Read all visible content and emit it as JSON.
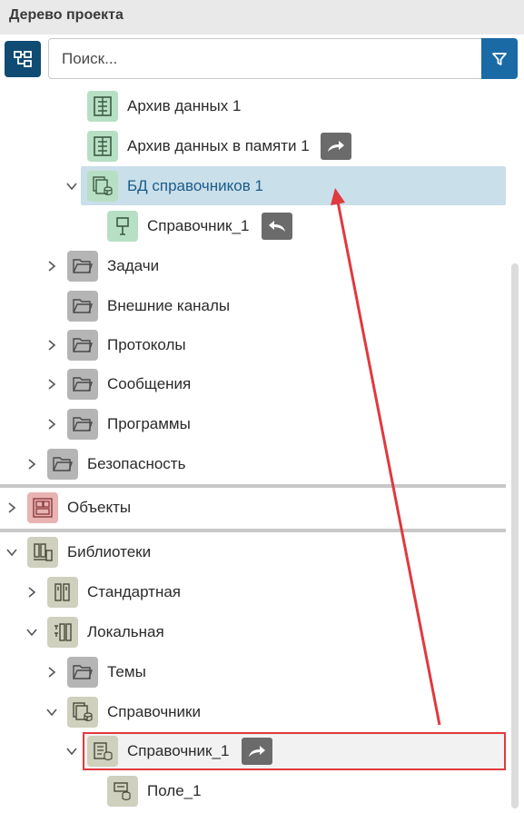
{
  "panel": {
    "title": "Дерево проекта"
  },
  "search": {
    "placeholder": "Поиск..."
  },
  "tree": {
    "archive_1": "Архив данных 1",
    "archive_mem": "Архив данных в памяти 1",
    "db_refs": "БД справочников 1",
    "ref_1": "Справочник_1",
    "tasks": "Задачи",
    "ext_channels": "Внешние каналы",
    "protocols": "Протоколы",
    "messages": "Сообщения",
    "programs": "Программы",
    "security": "Безопасность",
    "objects": "Объекты",
    "libraries": "Библиотеки",
    "standard": "Стандартная",
    "local": "Локальная",
    "themes": "Темы",
    "refs_folder": "Справочники",
    "lib_ref_1": "Справочник_1",
    "field_1": "Поле_1"
  },
  "colors": {
    "accent": "#0f4b73",
    "filter": "#1a6aa5",
    "selection": "#c9dfe9",
    "annotation": "#e0393e"
  },
  "icons": {
    "tree_view": "tree-structure-icon",
    "filter": "filter-icon",
    "archive": "archive-icon",
    "database": "database-icon",
    "reference": "reference-icon",
    "folder": "folder-icon",
    "objects": "objects-icon",
    "library": "library-icon",
    "forward_link": "forward-arrow-icon",
    "back_link": "back-arrow-icon"
  }
}
